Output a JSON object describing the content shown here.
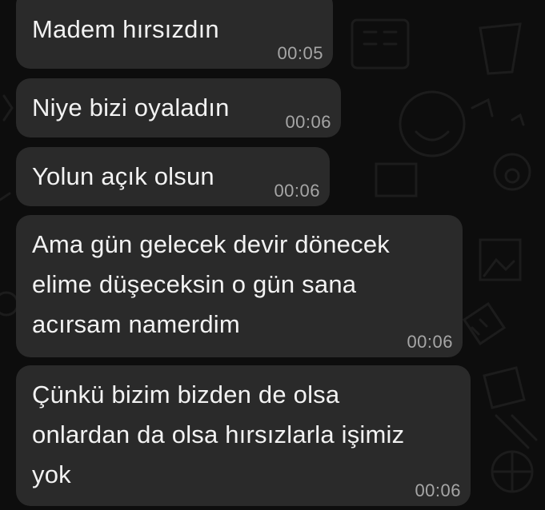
{
  "messages": [
    {
      "text": "Madem hırsızdın",
      "time": "00:05"
    },
    {
      "text": "Niye bizi oyaladın",
      "time": "00:06"
    },
    {
      "text": "Yolun açık olsun",
      "time": "00:06"
    },
    {
      "text": "Ama gün gelecek devir dönecek\nelime düşeceksin o gün sana\nacırsam namerdim",
      "time": "00:06"
    },
    {
      "text": "Çünkü bizim bizden de olsa\nonlardan da olsa hırsızlarla işimiz\nyok",
      "time": "00:06"
    }
  ],
  "colors": {
    "background": "#0d0d0d",
    "bubble": "#2a2a2a",
    "text": "#f2f2f2",
    "time": "#a6a6a6"
  }
}
